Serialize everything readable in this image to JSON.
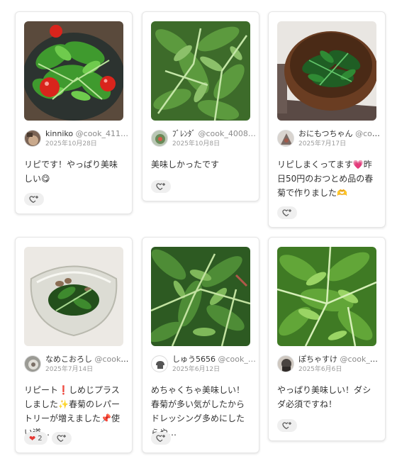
{
  "cards": [
    {
      "name": "kinniko",
      "handle": "@cook_411…",
      "date": "2025年10月28日",
      "comment": "リピです！やっぱり美味しい😋",
      "image": "salad-tomato-icon"
    },
    {
      "name": "ﾌﾞﾚﾝﾀﾞ",
      "handle": "@cook_4008…",
      "date": "2025年10月8日",
      "comment": "美味しかったです",
      "image": "raw-leaves-icon"
    },
    {
      "name": "おにもつちゃん",
      "handle": "@coo…",
      "date": "2025年7月17日",
      "comment": "リピしまくってます💗昨日50円のおつとめ品の春菊で作りました🫶",
      "image": "bowl-greens-icon"
    },
    {
      "name": "なめこおろし",
      "handle": "@cook_…",
      "date": "2025年7月14日",
      "comment": "リピート❗️しめじプラスしました✨春菊のレパートリーが増えました📌使い道…",
      "image": "glass-bowl-icon",
      "heart_count": "2"
    },
    {
      "name": "しゅう5656",
      "handle": "@cook_…",
      "date": "2025年6月12日",
      "comment": "めちゃくちゃ美味しい！ 春菊が多い気がしたからドレッシング多めにしたらや…",
      "image": "greens-closeup-icon"
    },
    {
      "name": "ぽちゃすけ",
      "handle": "@cook_4…",
      "date": "2025年6月6日",
      "comment": "やっぱり美味しい！ダシダ必須ですね！",
      "image": "fresh-greens-icon"
    }
  ],
  "colors": {
    "greens_dark": "#2e6b1e",
    "greens_light": "#7cc84a",
    "tomato": "#d9241c",
    "heart": "#e53935"
  }
}
